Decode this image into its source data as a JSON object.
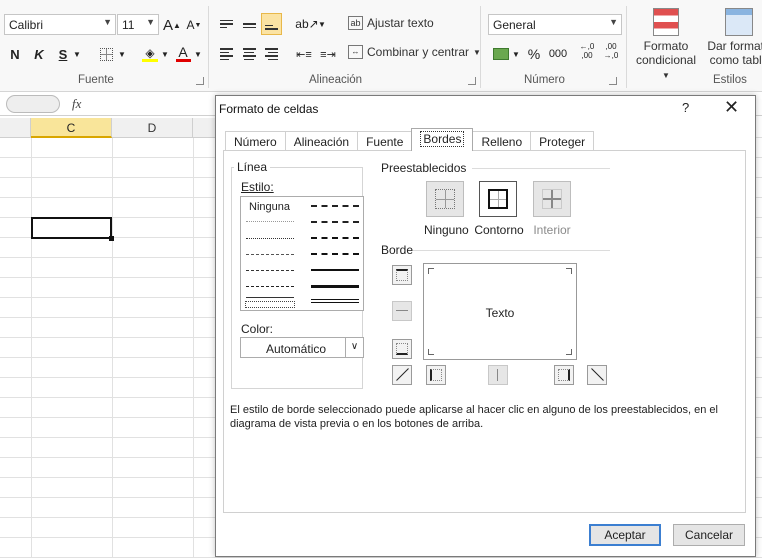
{
  "ribbon": {
    "font_name": "Calibri",
    "font_size": "11",
    "grow_font": "A",
    "shrink_font": "A",
    "bold": "N",
    "italic": "K",
    "underline": "S",
    "font_color_letter": "A",
    "wrap_text": "Ajustar texto",
    "merge_center": "Combinar y centrar",
    "number_format": "General",
    "percent": "%",
    "thousands": "000",
    "inc_decimal": "←,0",
    "inc_decimal_sub": ",00",
    "dec_decimal": ",00",
    "dec_decimal_sub": "→,0",
    "cond_format_l1": "Formato",
    "cond_format_l2": "condicional",
    "table_format_l1": "Dar formato",
    "table_format_l2": "como tabla",
    "group_font": "Fuente",
    "group_alignment": "Alineación",
    "group_number": "Número",
    "group_styles": "Estilos"
  },
  "formula_bar": {
    "fx": "fx"
  },
  "grid": {
    "columns": [
      "C",
      "D"
    ],
    "active_column": "C"
  },
  "dialog": {
    "title": "Formato de celdas",
    "help": "?",
    "close": "✕",
    "tabs": [
      {
        "label": "Número"
      },
      {
        "label": "Alineación"
      },
      {
        "label": "Fuente"
      },
      {
        "label": "Bordes"
      },
      {
        "label": "Relleno"
      },
      {
        "label": "Proteger"
      }
    ],
    "active_tab": "Bordes",
    "line_group": "Línea",
    "style_label": "Estilo:",
    "style_none": "Ninguna",
    "color_label": "Color:",
    "color_value": "Automático",
    "presets_title": "Preestablecidos",
    "presets": [
      {
        "label": "Ninguno"
      },
      {
        "label": "Contorno"
      },
      {
        "label": "Interior"
      }
    ],
    "border_title": "Borde",
    "preview_text": "Texto",
    "hint": "El estilo de borde seleccionado puede aplicarse al hacer clic en alguno de los preestablecidos, en el diagrama de vista previa o en los botones de arriba.",
    "ok": "Aceptar",
    "cancel": "Cancelar"
  },
  "colors": {
    "accent_selection": "#fbe3a3",
    "active_column": "#f9e59a",
    "primary_button_border": "#3c7fd1",
    "font_color_bar": "#e00000",
    "highlight_bar": "#ffff00"
  }
}
